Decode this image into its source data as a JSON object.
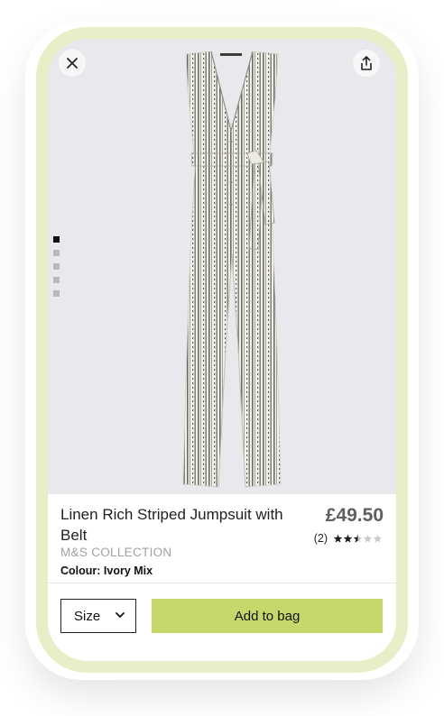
{
  "product": {
    "title": "Linen Rich Striped Jumpsuit with Belt",
    "brand": "M&S COLLECTION",
    "colour": "Colour: Ivory Mix",
    "price": "£49.50",
    "rating_count": "(2)",
    "rating_value": 2.5,
    "rating_max": 5
  },
  "gallery": {
    "image_count": 5,
    "active_index": 0
  },
  "actions": {
    "size_label": "Size",
    "add_to_bag_label": "Add to bag"
  },
  "icons": {
    "close": "close-icon",
    "share": "share-icon",
    "chevron": "chevron-down-icon",
    "star": "star-icon"
  },
  "colors": {
    "accent": "#c6d86b",
    "frame": "#e6efc7",
    "hero_background": "#e9e8ec",
    "price": "#5f5f5f",
    "brand_text": "#a2a2a2"
  }
}
